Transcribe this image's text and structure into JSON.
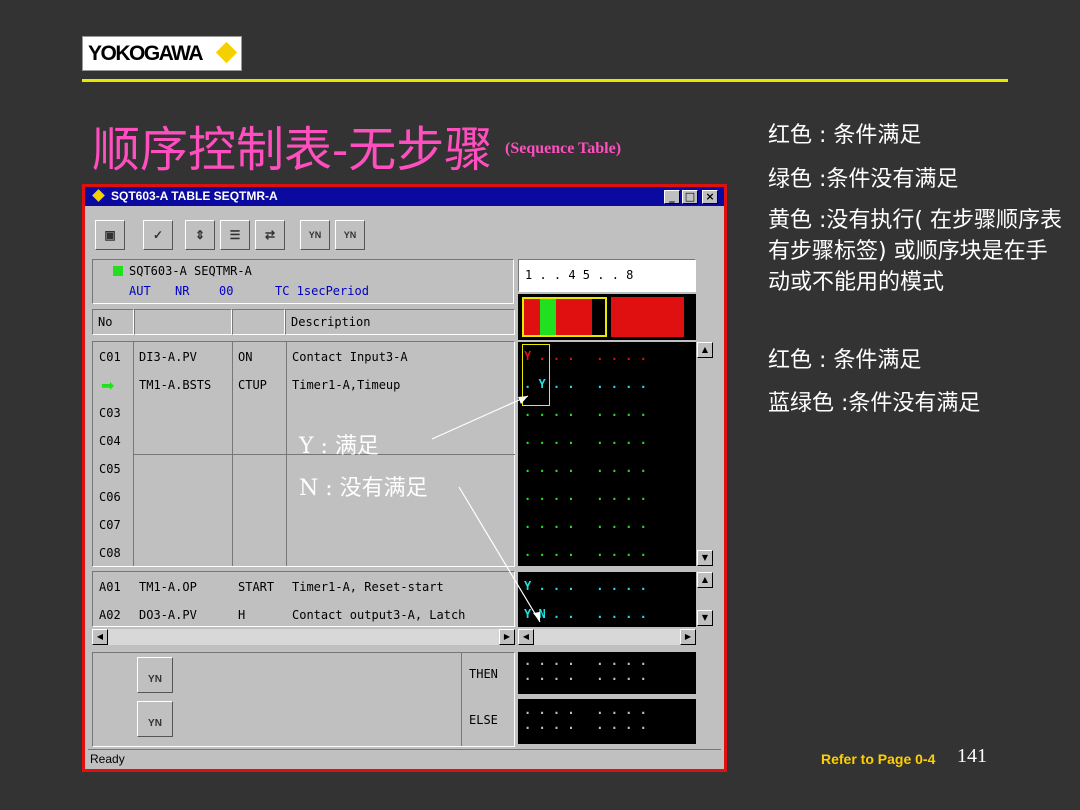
{
  "logo": {
    "text": "YOKOGAWA"
  },
  "slide": {
    "title": "顺序控制表-无步骤",
    "subtitle": "(Sequence Table)",
    "legend": [
      "红色 : 条件满足",
      "绿色 :条件没有满足",
      "黄色 :没有执行( 在步骤顺序表有步骤标签) 或顺序块是在手动或不能用的模式",
      "红色 : 条件满足",
      "蓝绿色 :条件没有满足"
    ],
    "annotations": {
      "y": "Y : 满足",
      "n": "N : 没有满足"
    },
    "refer": "Refer to Page 0-4",
    "page_number": "141"
  },
  "window": {
    "title": "SQT603-A TABLE SEQTMR-A",
    "controls": [
      "_",
      "□",
      "×"
    ],
    "toolbar": [
      "YN",
      "YN"
    ],
    "tag_line1": "SQT603-A SEQTMR-A",
    "tag_line2": {
      "mode": "AUT",
      "alarm": "NR",
      "value": "00",
      "tc": "TC 1secPeriod"
    },
    "step_header": "1 . . 4   5 . . 8",
    "col_no": "No",
    "col_desc": "Description",
    "conditions": [
      {
        "no": "C01",
        "tag": "DI3-A.PV",
        "data": "ON",
        "desc": "Contact Input3-A",
        "marks": "Y . . .   . . . ."
      },
      {
        "no": "",
        "tag": "TM1-A.BSTS",
        "data": "CTUP",
        "desc": "Timer1-A,Timeup",
        "marks": ". Y . .   . . . ."
      },
      {
        "no": "C03",
        "tag": "",
        "data": "",
        "desc": "",
        "marks": ". . . .   . . . ."
      },
      {
        "no": "C04",
        "tag": "",
        "data": "",
        "desc": "",
        "marks": ". . . .   . . . ."
      },
      {
        "no": "C05",
        "tag": "",
        "data": "",
        "desc": "",
        "marks": ". . . .   . . . ."
      },
      {
        "no": "C06",
        "tag": "",
        "data": "",
        "desc": "",
        "marks": ". . . .   . . . ."
      },
      {
        "no": "C07",
        "tag": "",
        "data": "",
        "desc": "",
        "marks": ". . . .   . . . ."
      },
      {
        "no": "C08",
        "tag": "",
        "data": "",
        "desc": "",
        "marks": ". . . .   . . . ."
      }
    ],
    "actions": [
      {
        "no": "A01",
        "tag": "TM1-A.OP",
        "data": "START",
        "desc": "Timer1-A, Reset-start",
        "marks": "Y . . .   . . . ."
      },
      {
        "no": "A02",
        "tag": "DO3-A.PV",
        "data": "H",
        "desc": "Contact output3-A, Latch",
        "marks": "Y N . .   . . . ."
      }
    ],
    "then_label": "THEN",
    "else_label": "ELSE",
    "yn_label": "YN",
    "status": "Ready"
  },
  "colors": {
    "title": "#ff4fbf",
    "refer": "#ffd000",
    "rule": "#e8e800",
    "satisfied": "#e01010",
    "not_satisfied": "#20e020",
    "pending": "#e8e800",
    "titlebar": "#0a0aa0"
  }
}
